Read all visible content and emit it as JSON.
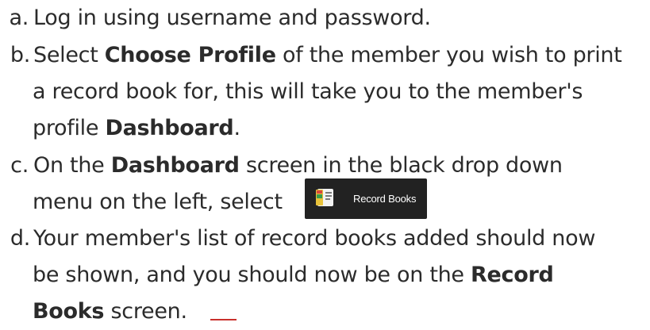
{
  "steps": [
    {
      "marker": "a.",
      "lines": [
        [
          {
            "t": "Log in using username and password."
          }
        ]
      ]
    },
    {
      "marker": "b.",
      "lines": [
        [
          {
            "t": "Select "
          },
          {
            "t": "Choose Profile",
            "b": true
          },
          {
            "t": " of the member you wish to print"
          }
        ],
        [
          {
            "t": "a record book for, this will take you to the member's"
          }
        ],
        [
          {
            "t": "profile "
          },
          {
            "t": "Dashboard",
            "b": true
          },
          {
            "t": "."
          }
        ]
      ]
    },
    {
      "marker": "c.",
      "lines": [
        [
          {
            "t": "On the "
          },
          {
            "t": "Dashboard",
            "b": true
          },
          {
            "t": " screen in the black drop down"
          }
        ],
        [
          {
            "t": "menu on the left, select"
          }
        ]
      ]
    },
    {
      "marker": "d.",
      "lines": [
        [
          {
            "t": "Your member's list of record books added should now"
          }
        ],
        [
          {
            "t": "be shown, and you should now be on the "
          },
          {
            "t": "Record",
            "b": true
          }
        ],
        [
          {
            "t": "Books",
            "b": true
          },
          {
            "t": " screen."
          }
        ]
      ]
    }
  ],
  "menu_button": {
    "label": "Record Books",
    "icon": "record-books-icon"
  }
}
